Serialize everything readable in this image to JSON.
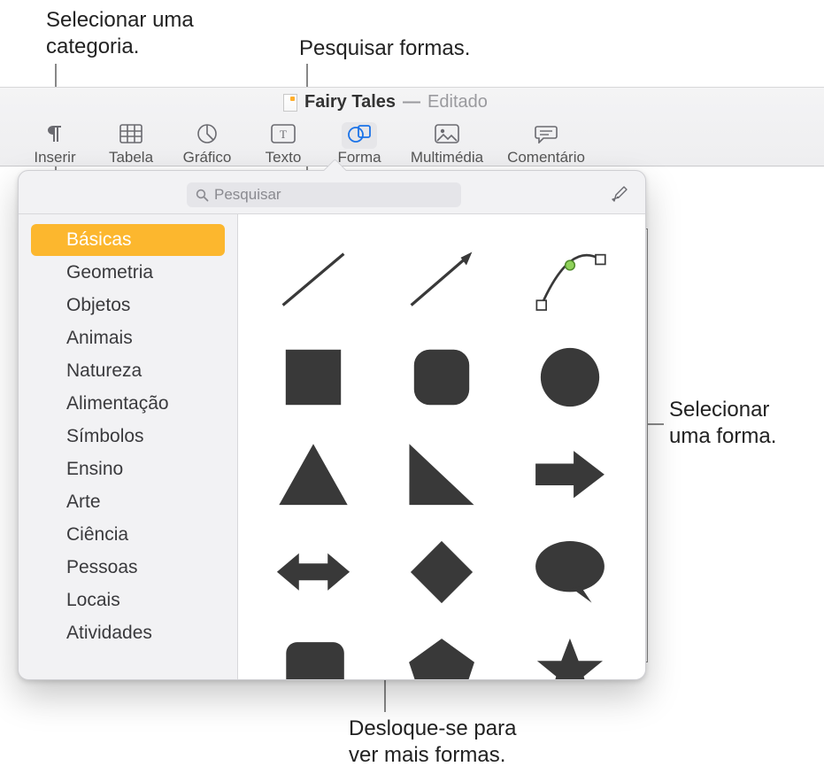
{
  "callouts": {
    "select_category": "Selecionar uma\ncategoria.",
    "search_shapes": "Pesquisar formas.",
    "select_shape": "Selecionar\numa forma.",
    "scroll_more": "Desloque-se para\nver mais formas."
  },
  "titlebar": {
    "doc_name": "Fairy Tales",
    "separator": "—",
    "status": "Editado"
  },
  "toolbar": {
    "inserir": "Inserir",
    "tabela": "Tabela",
    "grafico": "Gráfico",
    "texto": "Texto",
    "forma": "Forma",
    "multimedia": "Multimédia",
    "comentario": "Comentário"
  },
  "search": {
    "placeholder": "Pesquisar"
  },
  "sidebar": {
    "items": [
      "Básicas",
      "Geometria",
      "Objetos",
      "Animais",
      "Natureza",
      "Alimentação",
      "Símbolos",
      "Ensino",
      "Arte",
      "Ciência",
      "Pessoas",
      "Locais",
      "Atividades"
    ],
    "selected_index": 0
  },
  "shapes": [
    "line",
    "arrow-line",
    "bezier-curve",
    "square",
    "rounded-square",
    "circle",
    "triangle",
    "right-triangle",
    "arrow-right",
    "arrow-bidirectional",
    "diamond",
    "speech-bubble",
    "callout-square",
    "pentagon",
    "star"
  ]
}
